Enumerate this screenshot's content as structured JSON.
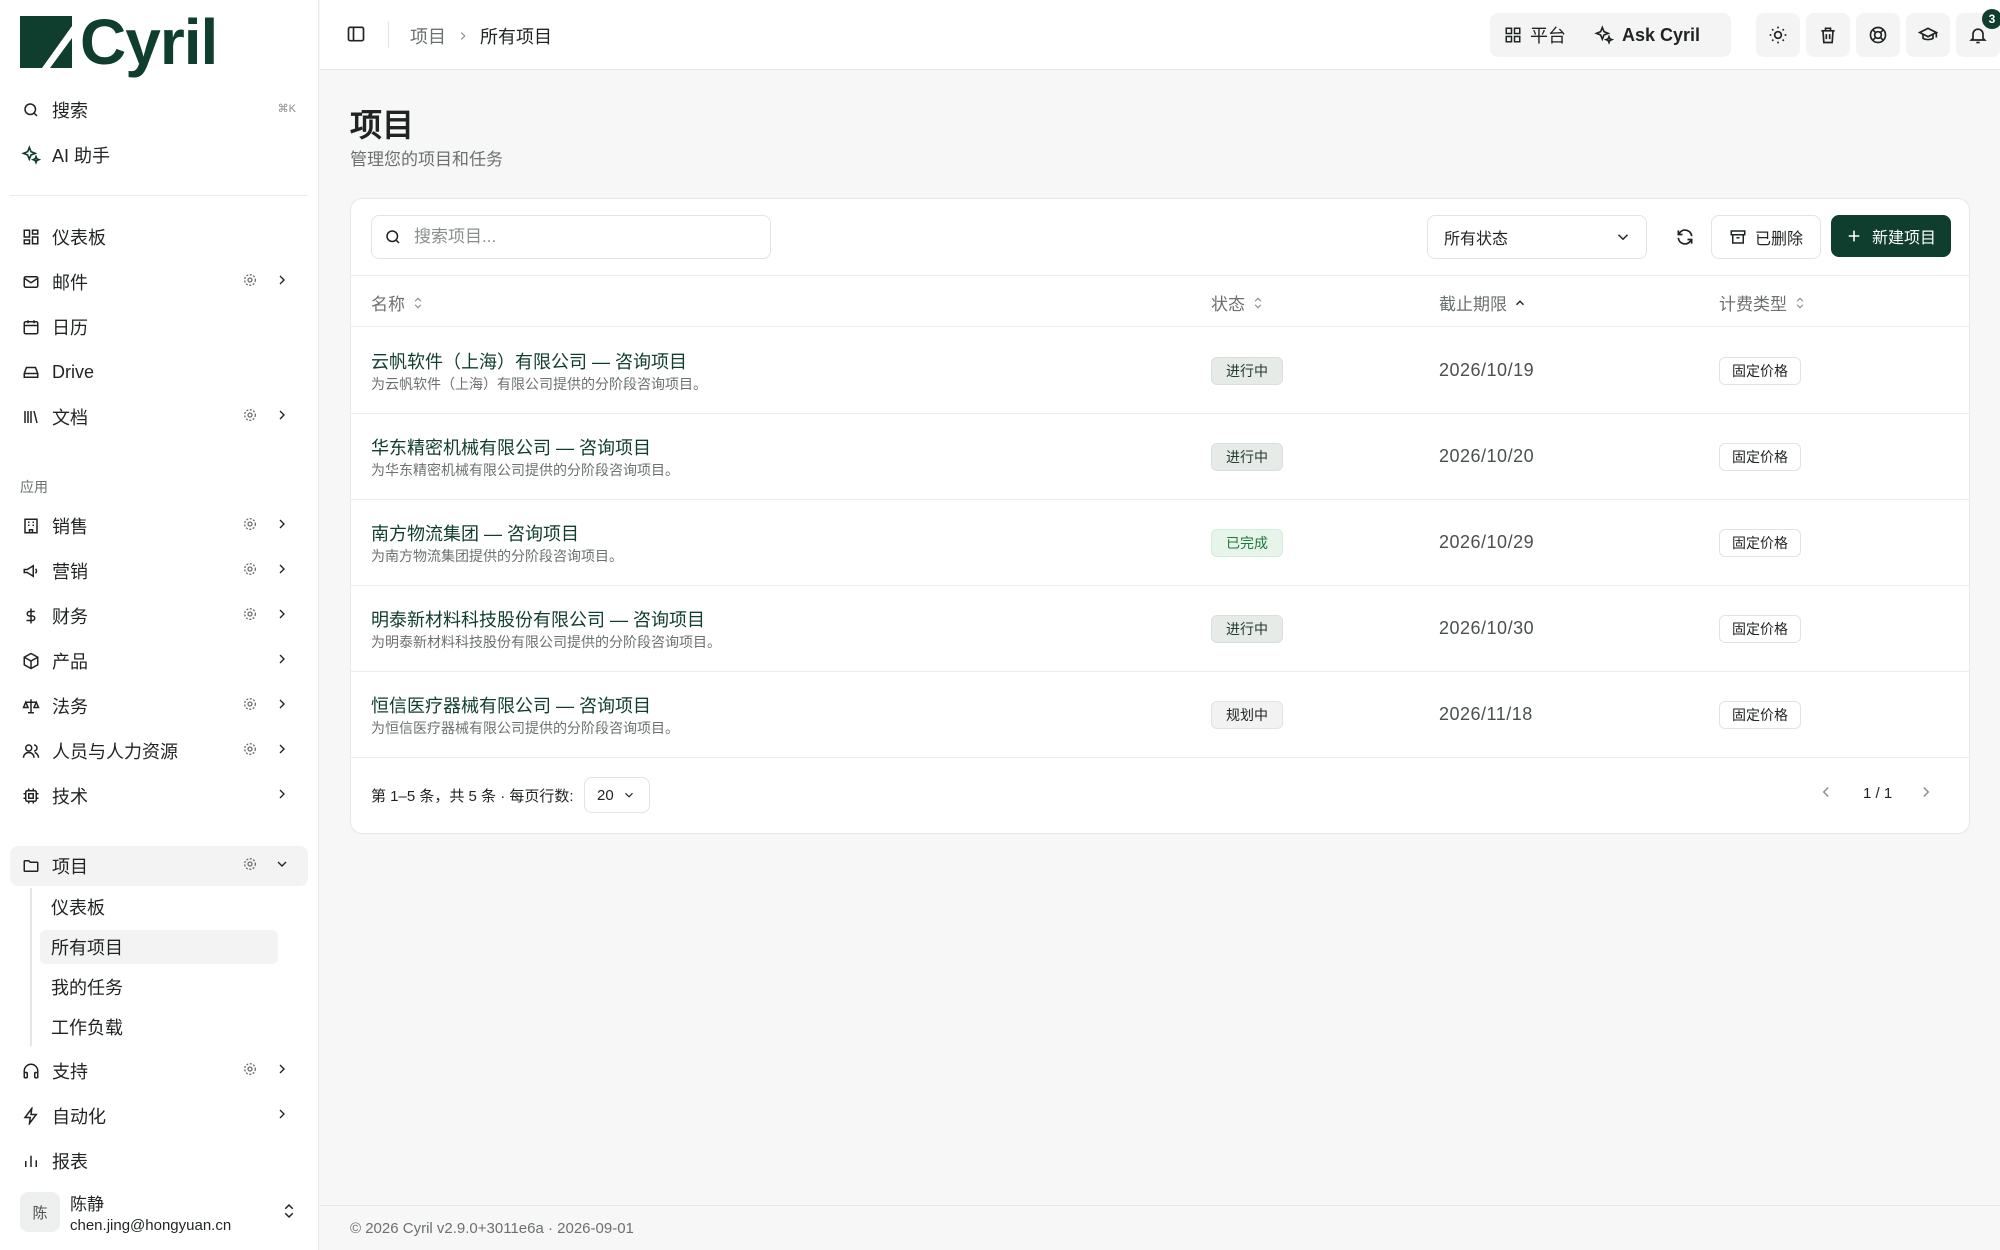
{
  "brand": {
    "name": "Cyril",
    "color": "#0f3d2e"
  },
  "sidebar": {
    "search_label": "搜索",
    "search_shortcut": "⌘K",
    "ai_label": "AI 助手",
    "items": [
      {
        "label": "仪表板",
        "icon": "dashboard-icon"
      },
      {
        "label": "邮件",
        "icon": "mail-icon"
      },
      {
        "label": "日历",
        "icon": "calendar-icon"
      },
      {
        "label": "Drive",
        "icon": "drive-icon"
      },
      {
        "label": "文档",
        "icon": "library-icon"
      }
    ],
    "apps_label": "应用",
    "apps": [
      {
        "label": "销售"
      },
      {
        "label": "营销"
      },
      {
        "label": "财务"
      },
      {
        "label": "产品"
      },
      {
        "label": "法务"
      },
      {
        "label": "人员与人力资源"
      },
      {
        "label": "技术"
      }
    ],
    "projects": {
      "label": "项目",
      "sub": [
        "仪表板",
        "所有项目",
        "我的任务",
        "工作负载"
      ]
    },
    "support_label": "支持",
    "automation_label": "自动化",
    "reports_label": "报表",
    "user": {
      "initial": "陈",
      "name": "陈静",
      "email": "chen.jing@hongyuan.cn"
    }
  },
  "topbar": {
    "breadcrumb_parent": "项目",
    "breadcrumb_current": "所有项目",
    "platform_label": "平台",
    "ask_label": "Ask Cyril",
    "notifications_count": "3"
  },
  "page": {
    "title": "项目",
    "subtitle": "管理您的项目和任务"
  },
  "toolbar": {
    "search_placeholder": "搜索项目...",
    "status_filter": "所有状态",
    "deleted_label": "已删除",
    "new_label": "新建项目"
  },
  "table": {
    "columns": [
      "名称",
      "状态",
      "截止期限",
      "计费类型"
    ],
    "rows": [
      {
        "name": "云帆软件（上海）有限公司 — 咨询项目",
        "desc": "为云帆软件（上海）有限公司提供的分阶段咨询项目。",
        "status": "进行中",
        "deadline": "2026/10/19",
        "billing": "固定价格"
      },
      {
        "name": "华东精密机械有限公司 — 咨询项目",
        "desc": "为华东精密机械有限公司提供的分阶段咨询项目。",
        "status": "进行中",
        "deadline": "2026/10/20",
        "billing": "固定价格"
      },
      {
        "name": "南方物流集团 — 咨询项目",
        "desc": "为南方物流集团提供的分阶段咨询项目。",
        "status": "已完成",
        "deadline": "2026/10/29",
        "billing": "固定价格"
      },
      {
        "name": "明泰新材料科技股份有限公司 — 咨询项目",
        "desc": "为明泰新材料科技股份有限公司提供的分阶段咨询项目。",
        "status": "进行中",
        "deadline": "2026/10/30",
        "billing": "固定价格"
      },
      {
        "name": "恒信医疗器械有限公司 — 咨询项目",
        "desc": "为恒信医疗器械有限公司提供的分阶段咨询项目。",
        "status": "规划中",
        "deadline": "2026/11/18",
        "billing": "固定价格"
      }
    ]
  },
  "pagination": {
    "info": "第 1–5 条，共 5 条 · 每页行数:",
    "per_page": "20",
    "page": "1 / 1"
  },
  "footer": {
    "text": "© 2026 Cyril v2.9.0+3011e6a · 2026-09-01"
  }
}
